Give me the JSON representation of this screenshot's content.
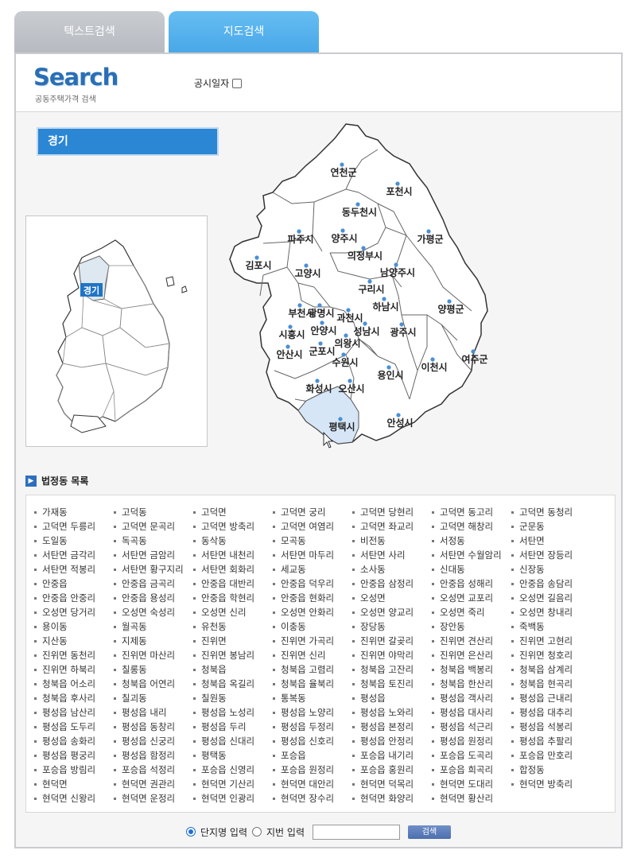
{
  "tabs": [
    {
      "label": "텍스트검색"
    },
    {
      "label": "지도검색"
    }
  ],
  "header": {
    "logo_text": "Search",
    "logo_sub": "공동주택가격 검색",
    "pubdate_label": "공시일자"
  },
  "region": {
    "selected": "경기"
  },
  "minimap": {
    "label": "경기"
  },
  "map_labels": [
    "연천군",
    "포천시",
    "동두천시",
    "파주시",
    "양주시",
    "가평군",
    "김포시",
    "의정부시",
    "고양시",
    "남양주시",
    "구리시",
    "부천시",
    "광명시",
    "과천시",
    "하남시",
    "양평군",
    "시흥시",
    "안양시",
    "의왕시",
    "성남시",
    "광주시",
    "안산시",
    "군포시",
    "수원시",
    "용인시",
    "이천시",
    "여주군",
    "화성시",
    "오산시",
    "평택시",
    "안성시"
  ],
  "list_title": "법정동 목록",
  "dong_list": [
    "가재동",
    "고덕동",
    "고덕면",
    "고덕면 궁리",
    "고덕면 당현리",
    "고덕면 동고리",
    "고덕면 동청리",
    "고덕면 두릉리",
    "고덕면 문곡리",
    "고덕면 방축리",
    "고덕면 여염리",
    "고덕면 좌교리",
    "고덕면 해창리",
    "군문동",
    "도일동",
    "독곡동",
    "동삭동",
    "모곡동",
    "비전동",
    "서정동",
    "서탄면",
    "서탄면 금각리",
    "서탄면 금암리",
    "서탄면 내천리",
    "서탄면 마두리",
    "서탄면 사리",
    "서탄면 수월암리",
    "서탄면 장등리",
    "서탄면 적봉리",
    "서탄면 황구지리",
    "서탄면 회화리",
    "세교동",
    "소사동",
    "신대동",
    "신장동",
    "안중읍",
    "안중읍 금곡리",
    "안중읍 대반리",
    "안중읍 덕우리",
    "안중읍 삼정리",
    "안중읍 성해리",
    "안중읍 송담리",
    "안중읍 안중리",
    "안중읍 용성리",
    "안중읍 학현리",
    "안중읍 현화리",
    "오성면",
    "오성면 교포리",
    "오성면 길음리",
    "오성면 당거리",
    "오성면 숙성리",
    "오성면 신리",
    "오성면 안화리",
    "오성면 양교리",
    "오성면 죽리",
    "오성면 창내리",
    "용이동",
    "월곡동",
    "유천동",
    "이충동",
    "장당동",
    "장안동",
    "죽백동",
    "지산동",
    "지제동",
    "진위면",
    "진위면 가곡리",
    "진위면 갈곶리",
    "진위면 견산리",
    "진위면 고현리",
    "진위면 동천리",
    "진위면 마산리",
    "진위면 봉남리",
    "진위면 신리",
    "진위면 야막리",
    "진위면 은산리",
    "진위면 청호리",
    "진위면 하북리",
    "칠롱동",
    "청북읍",
    "청북읍 고렴리",
    "청북읍 고잔리",
    "청북읍 백봉리",
    "청북읍 삼계리",
    "청북읍 어소리",
    "청북읍 어연리",
    "청북읍 옥길리",
    "청북읍 율북리",
    "청북읍 토진리",
    "청북읍 한산리",
    "청북읍 현곡리",
    "청북읍 후사리",
    "칠괴동",
    "칠원동",
    "통복동",
    "평성읍",
    "평성읍 객사리",
    "평성읍 근내리",
    "평성읍 남산리",
    "평성읍 내리",
    "평성읍 노성리",
    "평성읍 노양리",
    "평성읍 노와리",
    "평성읍 대사리",
    "평성읍 대추리",
    "평성읍 도두리",
    "평성읍 동창리",
    "평성읍 두리",
    "평성읍 두정리",
    "평성읍 본정리",
    "평성읍 석근리",
    "평성읍 석봉리",
    "평성읍 송화리",
    "평성읍 신궁리",
    "평성읍 신대리",
    "평성읍 신호리",
    "평성읍 안정리",
    "평성읍 원정리",
    "평성읍 추팔리",
    "평성읍 평궁리",
    "평성읍 함정리",
    "평택동",
    "포승읍",
    "포승읍 내기리",
    "포승읍 도곡리",
    "포승읍 만호리",
    "포승읍 방림리",
    "포승읍 석정리",
    "포승읍 신영리",
    "포승읍 원정리",
    "포승읍 홍원리",
    "포승읍 희곡리",
    "합정동",
    "현덕면",
    "현덕면 권관리",
    "현덕면 기산리",
    "현덕면 대안리",
    "현덕면 덕목리",
    "현덕면 도대리",
    "현덕면 방축리",
    "현덕면 신왕리",
    "현덕면 운정리",
    "현덕면 인광리",
    "현덕면 장수리",
    "현덕면 화양리",
    "현덕면 황산리"
  ],
  "search": {
    "radio1": "단지명 입력",
    "radio2": "지번 입력",
    "button": "검색"
  },
  "colors": {
    "accent": "#2b86d4",
    "active_tab": "#49a8e8",
    "highlight": "#d6e6f7"
  }
}
